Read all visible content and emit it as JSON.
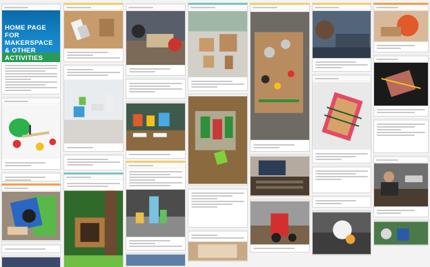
{
  "hero": {
    "line1": "HOME PAGE FOR",
    "line2": "MAKERSPACE",
    "line3": "& OTHER ACTIVITIES"
  },
  "colors": {
    "hero_blue": "#0a6aa8",
    "hero_green": "#2a9a56",
    "accent_orange": "#f0a04b",
    "accent_yellow": "#f2d06b",
    "accent_teal": "#7cc4c4"
  }
}
